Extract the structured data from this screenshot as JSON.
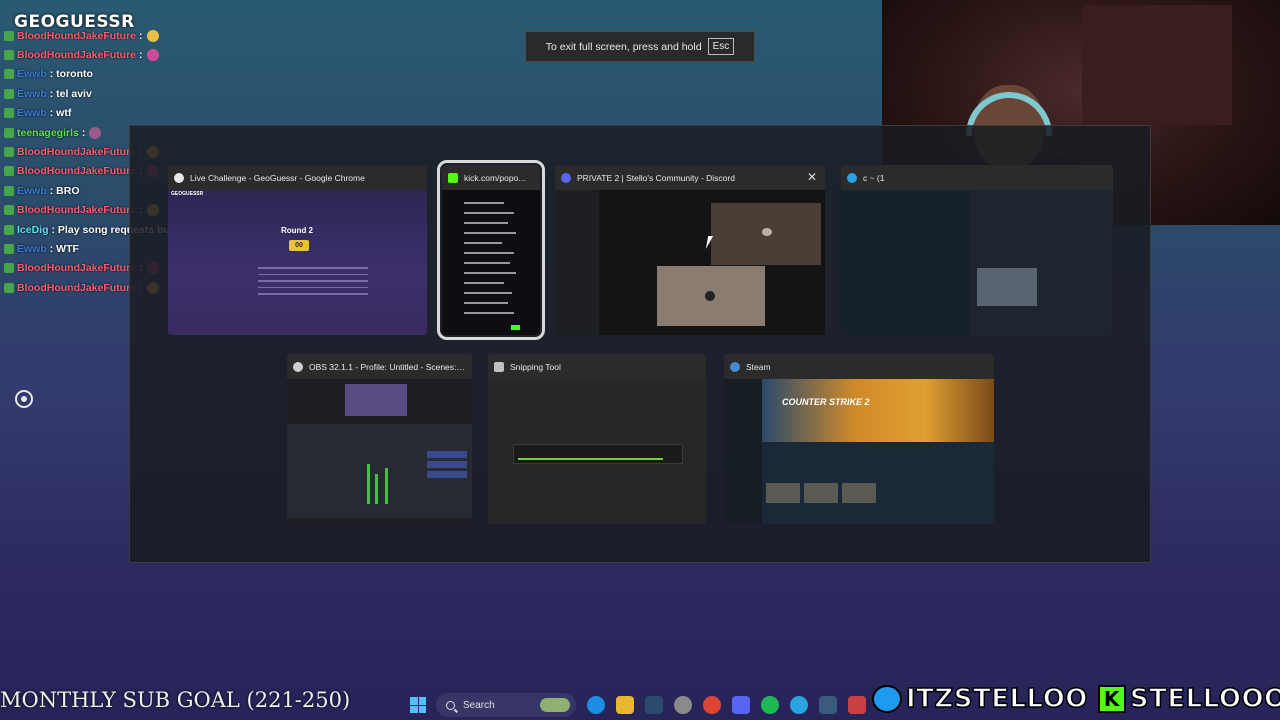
{
  "overlay": {
    "logo": "GEOGUESSR",
    "goal_text": "MONTHLY SUB GOAL (221-250)",
    "social_twitter": "ITZSTELLOO",
    "social_kick": "STELLOOO"
  },
  "chat": [
    {
      "user": "BloodHoundJakeFuture",
      "msg": "",
      "user_color": "#ff5a6e",
      "emote": "#e8c048"
    },
    {
      "user": "BloodHoundJakeFuture",
      "msg": "",
      "user_color": "#ff5a6e",
      "emote": "#d04a9a"
    },
    {
      "user": "Ewwb",
      "msg": ": toronto",
      "user_color": "#3a7ad8",
      "emote": ""
    },
    {
      "user": "Ewwb",
      "msg": ": tel aviv",
      "user_color": "#3a7ad8",
      "emote": ""
    },
    {
      "user": "Ewwb",
      "msg": ": wtf",
      "user_color": "#3a7ad8",
      "emote": ""
    },
    {
      "user": "teenagegirls",
      "msg": ":",
      "user_color": "#5ae04a",
      "emote": "#9a5a8a"
    },
    {
      "user": "BloodHoundJakeFuture",
      "msg": "",
      "user_color": "#ff5a6e",
      "emote": "#e8c048"
    },
    {
      "user": "BloodHoundJakeFuture",
      "msg": "",
      "user_color": "#ff5a6e",
      "emote": "#d04a9a"
    },
    {
      "user": "Ewwb",
      "msg": ": BRO",
      "user_color": "#3a7ad8",
      "emote": ""
    },
    {
      "user": "BloodHoundJakeFuture",
      "msg": "",
      "user_color": "#ff5a6e",
      "emote": "#e8c048"
    },
    {
      "user": "IceDig",
      "msg": ": Play song requests bum",
      "user_color": "#5ae0f0",
      "emote": ""
    },
    {
      "user": "Ewwb",
      "msg": ": WTF",
      "user_color": "#3a7ad8",
      "emote": ""
    },
    {
      "user": "BloodHoundJakeFuture",
      "msg": "",
      "user_color": "#ff5a6e",
      "emote": "#d04a9a"
    },
    {
      "user": "BloodHoundJakeFuture",
      "msg": "",
      "user_color": "#ff5a6e",
      "emote": "#e8c048"
    }
  ],
  "toast": {
    "text": "To exit full screen, press and hold",
    "key": "Esc"
  },
  "windows": [
    {
      "title": "Live Challenge - GeoGuessr - Google Chrome",
      "icon_color": "#e8e8e8"
    },
    {
      "title": "kick.com/popo...",
      "icon_color": "#53fc18"
    },
    {
      "title": "PRIVATE 2 | Stello's Community - Discord",
      "icon_color": "#5865f2"
    },
    {
      "title": "c ~ (1",
      "icon_color": "#2aa3e0"
    },
    {
      "title": "OBS 32.1.1 - Profile: Untitled - Scenes: Un...",
      "icon_color": "#cfcfcf"
    },
    {
      "title": "Snipping Tool",
      "icon_color": "#c0c0c0"
    },
    {
      "title": "Steam",
      "icon_color": "#4a8ad0"
    }
  ],
  "geo_thumb": {
    "round": "Round 2",
    "timer": "00"
  },
  "steam_thumb": {
    "hero": "COUNTER STRIKE 2"
  },
  "taskbar": {
    "search_label": "Search"
  },
  "close_glyph": "✕"
}
